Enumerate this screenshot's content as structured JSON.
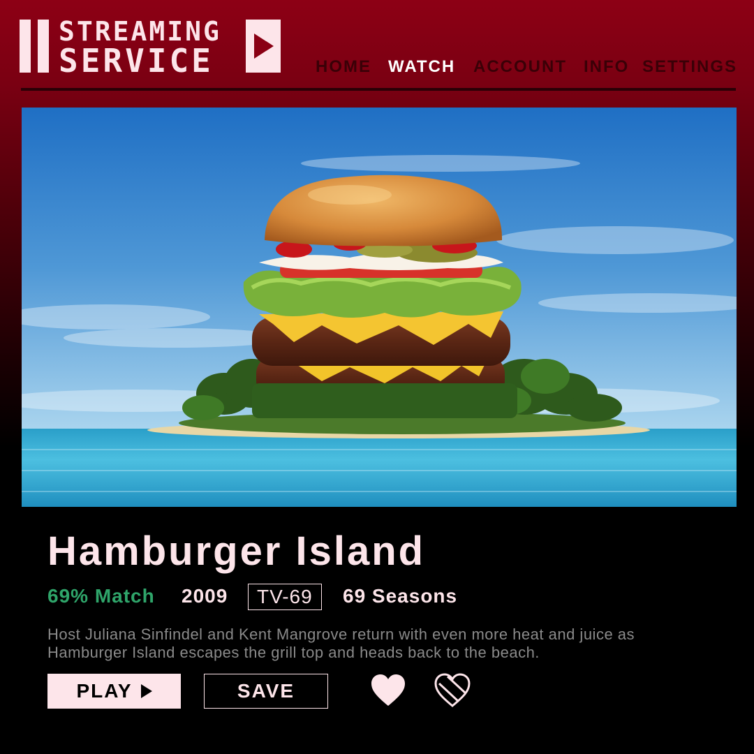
{
  "brand": {
    "line1": "STREAMING",
    "line2": "SERVICE",
    "logo_icon": "play-icon",
    "color": "#fde5ea"
  },
  "nav": {
    "items": [
      {
        "label": "HOME",
        "active": false
      },
      {
        "label": "WATCH",
        "active": true
      },
      {
        "label": "ACCOUNT",
        "active": false
      },
      {
        "label": "INFO",
        "active": false
      },
      {
        "label": "SETTINGS",
        "active": false
      }
    ]
  },
  "show": {
    "title": "Hamburger Island",
    "match": "69% Match",
    "year": "2009",
    "rating": "TV-69",
    "seasons": "69 Seasons",
    "description": "Host Juliana Sinfindel and Kent Mangrove return with even more heat and juice as Hamburger Island escapes the grill top and heads back to the beach."
  },
  "actions": {
    "play_label": "PLAY",
    "play_icon": "play-triangle-icon",
    "save_label": "SAVE",
    "like_icon": "heart-icon",
    "dislike_icon": "broken-heart-icon"
  },
  "colors": {
    "header_red": "#8d0015",
    "match_green": "#2fa56a",
    "text_light": "#fde5ea",
    "desc_gray": "#8a8a8a"
  }
}
